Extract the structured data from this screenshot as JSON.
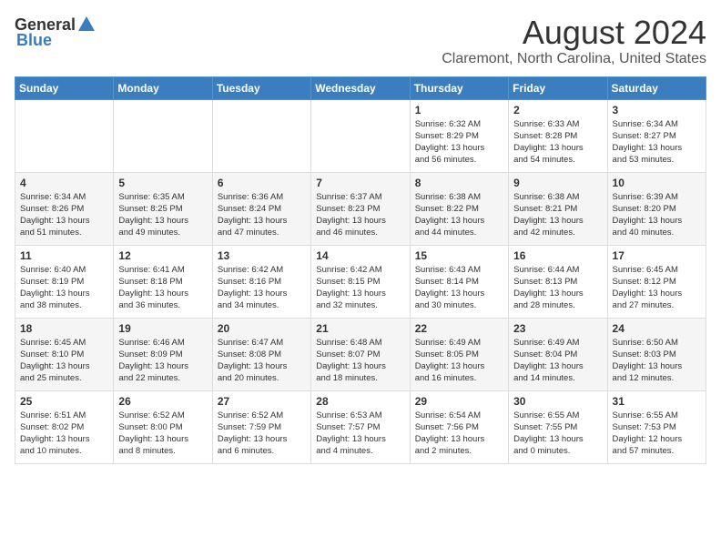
{
  "logo": {
    "general": "General",
    "blue": "Blue"
  },
  "title": "August 2024",
  "location": "Claremont, North Carolina, United States",
  "days_of_week": [
    "Sunday",
    "Monday",
    "Tuesday",
    "Wednesday",
    "Thursday",
    "Friday",
    "Saturday"
  ],
  "weeks": [
    [
      {
        "day": "",
        "content": ""
      },
      {
        "day": "",
        "content": ""
      },
      {
        "day": "",
        "content": ""
      },
      {
        "day": "",
        "content": ""
      },
      {
        "day": "1",
        "content": "Sunrise: 6:32 AM\nSunset: 8:29 PM\nDaylight: 13 hours\nand 56 minutes."
      },
      {
        "day": "2",
        "content": "Sunrise: 6:33 AM\nSunset: 8:28 PM\nDaylight: 13 hours\nand 54 minutes."
      },
      {
        "day": "3",
        "content": "Sunrise: 6:34 AM\nSunset: 8:27 PM\nDaylight: 13 hours\nand 53 minutes."
      }
    ],
    [
      {
        "day": "4",
        "content": "Sunrise: 6:34 AM\nSunset: 8:26 PM\nDaylight: 13 hours\nand 51 minutes."
      },
      {
        "day": "5",
        "content": "Sunrise: 6:35 AM\nSunset: 8:25 PM\nDaylight: 13 hours\nand 49 minutes."
      },
      {
        "day": "6",
        "content": "Sunrise: 6:36 AM\nSunset: 8:24 PM\nDaylight: 13 hours\nand 47 minutes."
      },
      {
        "day": "7",
        "content": "Sunrise: 6:37 AM\nSunset: 8:23 PM\nDaylight: 13 hours\nand 46 minutes."
      },
      {
        "day": "8",
        "content": "Sunrise: 6:38 AM\nSunset: 8:22 PM\nDaylight: 13 hours\nand 44 minutes."
      },
      {
        "day": "9",
        "content": "Sunrise: 6:38 AM\nSunset: 8:21 PM\nDaylight: 13 hours\nand 42 minutes."
      },
      {
        "day": "10",
        "content": "Sunrise: 6:39 AM\nSunset: 8:20 PM\nDaylight: 13 hours\nand 40 minutes."
      }
    ],
    [
      {
        "day": "11",
        "content": "Sunrise: 6:40 AM\nSunset: 8:19 PM\nDaylight: 13 hours\nand 38 minutes."
      },
      {
        "day": "12",
        "content": "Sunrise: 6:41 AM\nSunset: 8:18 PM\nDaylight: 13 hours\nand 36 minutes."
      },
      {
        "day": "13",
        "content": "Sunrise: 6:42 AM\nSunset: 8:16 PM\nDaylight: 13 hours\nand 34 minutes."
      },
      {
        "day": "14",
        "content": "Sunrise: 6:42 AM\nSunset: 8:15 PM\nDaylight: 13 hours\nand 32 minutes."
      },
      {
        "day": "15",
        "content": "Sunrise: 6:43 AM\nSunset: 8:14 PM\nDaylight: 13 hours\nand 30 minutes."
      },
      {
        "day": "16",
        "content": "Sunrise: 6:44 AM\nSunset: 8:13 PM\nDaylight: 13 hours\nand 28 minutes."
      },
      {
        "day": "17",
        "content": "Sunrise: 6:45 AM\nSunset: 8:12 PM\nDaylight: 13 hours\nand 27 minutes."
      }
    ],
    [
      {
        "day": "18",
        "content": "Sunrise: 6:45 AM\nSunset: 8:10 PM\nDaylight: 13 hours\nand 25 minutes."
      },
      {
        "day": "19",
        "content": "Sunrise: 6:46 AM\nSunset: 8:09 PM\nDaylight: 13 hours\nand 22 minutes."
      },
      {
        "day": "20",
        "content": "Sunrise: 6:47 AM\nSunset: 8:08 PM\nDaylight: 13 hours\nand 20 minutes."
      },
      {
        "day": "21",
        "content": "Sunrise: 6:48 AM\nSunset: 8:07 PM\nDaylight: 13 hours\nand 18 minutes."
      },
      {
        "day": "22",
        "content": "Sunrise: 6:49 AM\nSunset: 8:05 PM\nDaylight: 13 hours\nand 16 minutes."
      },
      {
        "day": "23",
        "content": "Sunrise: 6:49 AM\nSunset: 8:04 PM\nDaylight: 13 hours\nand 14 minutes."
      },
      {
        "day": "24",
        "content": "Sunrise: 6:50 AM\nSunset: 8:03 PM\nDaylight: 13 hours\nand 12 minutes."
      }
    ],
    [
      {
        "day": "25",
        "content": "Sunrise: 6:51 AM\nSunset: 8:02 PM\nDaylight: 13 hours\nand 10 minutes."
      },
      {
        "day": "26",
        "content": "Sunrise: 6:52 AM\nSunset: 8:00 PM\nDaylight: 13 hours\nand 8 minutes."
      },
      {
        "day": "27",
        "content": "Sunrise: 6:52 AM\nSunset: 7:59 PM\nDaylight: 13 hours\nand 6 minutes."
      },
      {
        "day": "28",
        "content": "Sunrise: 6:53 AM\nSunset: 7:57 PM\nDaylight: 13 hours\nand 4 minutes."
      },
      {
        "day": "29",
        "content": "Sunrise: 6:54 AM\nSunset: 7:56 PM\nDaylight: 13 hours\nand 2 minutes."
      },
      {
        "day": "30",
        "content": "Sunrise: 6:55 AM\nSunset: 7:55 PM\nDaylight: 13 hours\nand 0 minutes."
      },
      {
        "day": "31",
        "content": "Sunrise: 6:55 AM\nSunset: 7:53 PM\nDaylight: 12 hours\nand 57 minutes."
      }
    ]
  ]
}
